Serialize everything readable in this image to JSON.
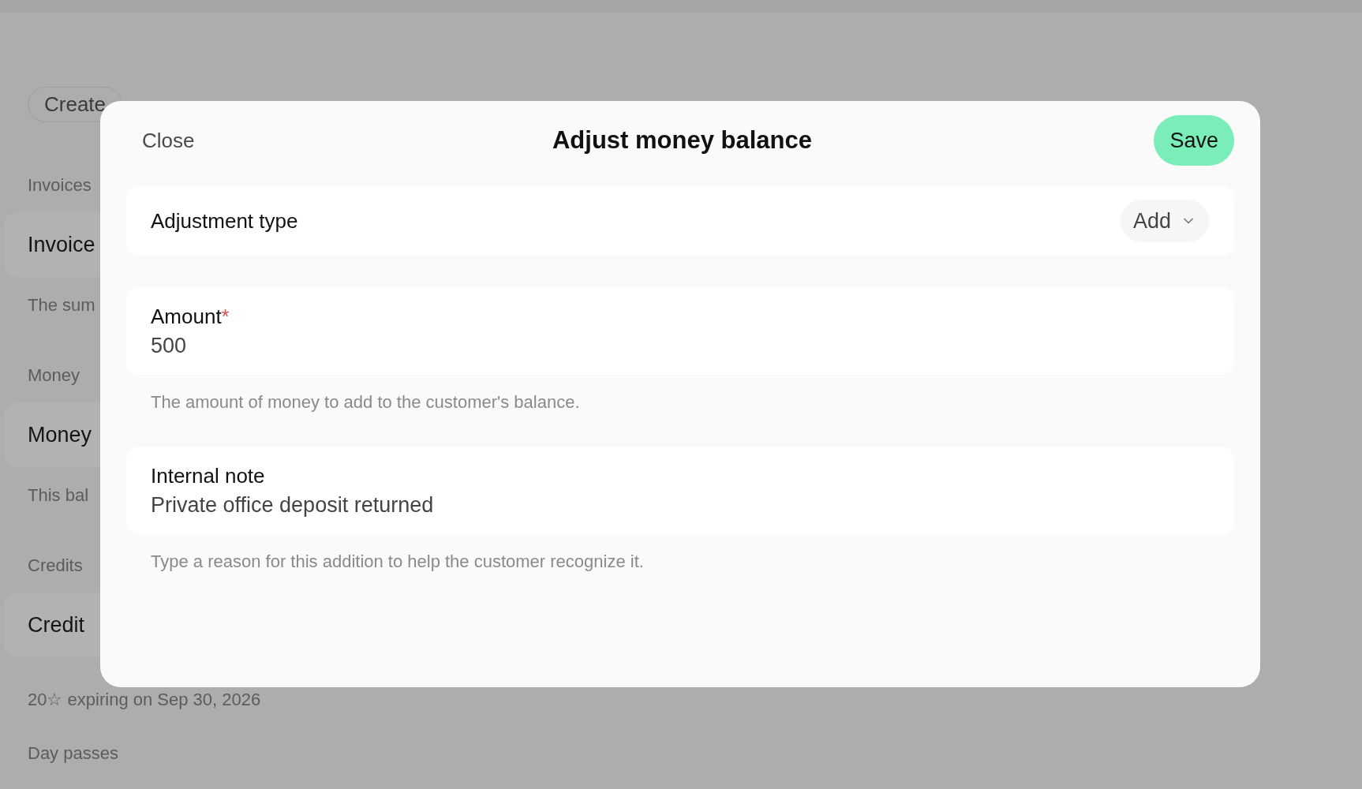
{
  "background": {
    "create_button": "Create",
    "sections": [
      {
        "label": "Invoices",
        "title": "Invoice",
        "caption": "The sum"
      },
      {
        "label": "Money",
        "title": "Money",
        "caption": "This bal"
      },
      {
        "label": "Credits",
        "title": "Credit",
        "caption": "20☆ expiring on Sep 30, 2026"
      }
    ],
    "last_label": "Day passes"
  },
  "dialog": {
    "close": "Close",
    "title": "Adjust money balance",
    "save": "Save",
    "fields": [
      {
        "kind": "select",
        "label": "Adjustment type",
        "value": "Add"
      },
      {
        "kind": "text",
        "label": "Amount",
        "required_mark": "*",
        "value": "500",
        "help": "The amount of money to add to the customer's balance."
      },
      {
        "kind": "text",
        "label": "Internal note",
        "value": "Private office deposit returned",
        "help": "Type a reason for this addition to help the customer recognize it."
      }
    ]
  }
}
